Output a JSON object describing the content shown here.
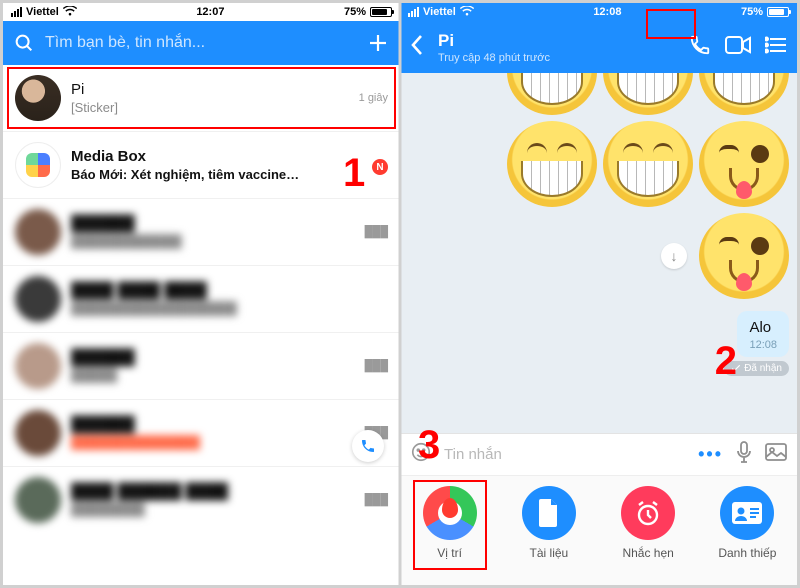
{
  "left": {
    "status": {
      "carrier": "Viettel",
      "time": "12:07",
      "battery": "75%"
    },
    "search_placeholder": "Tìm bạn bè, tin nhắn...",
    "rows": [
      {
        "name": "Pi",
        "sub": "[Sticker]",
        "meta": "1 giây"
      },
      {
        "name": "Media Box",
        "sub": "Báo Mới: Xét nghiệm, tiêm vaccine…",
        "meta": "",
        "badge": "N"
      }
    ]
  },
  "right": {
    "status": {
      "carrier": "Viettel",
      "time": "12:08",
      "battery": "75%"
    },
    "header": {
      "name": "Pi",
      "presence": "Truy cập 48 phút trước"
    },
    "bubble": {
      "text": "Alo",
      "time": "12:08"
    },
    "receipt": "Đã nhận",
    "input_placeholder": "Tin nhắn",
    "tray": {
      "location": "Vị trí",
      "docs": "Tài liệu",
      "reminder": "Nhắc hẹn",
      "contact": "Danh thiếp"
    }
  },
  "annotations": {
    "one": "1",
    "two": "2",
    "three": "3"
  }
}
